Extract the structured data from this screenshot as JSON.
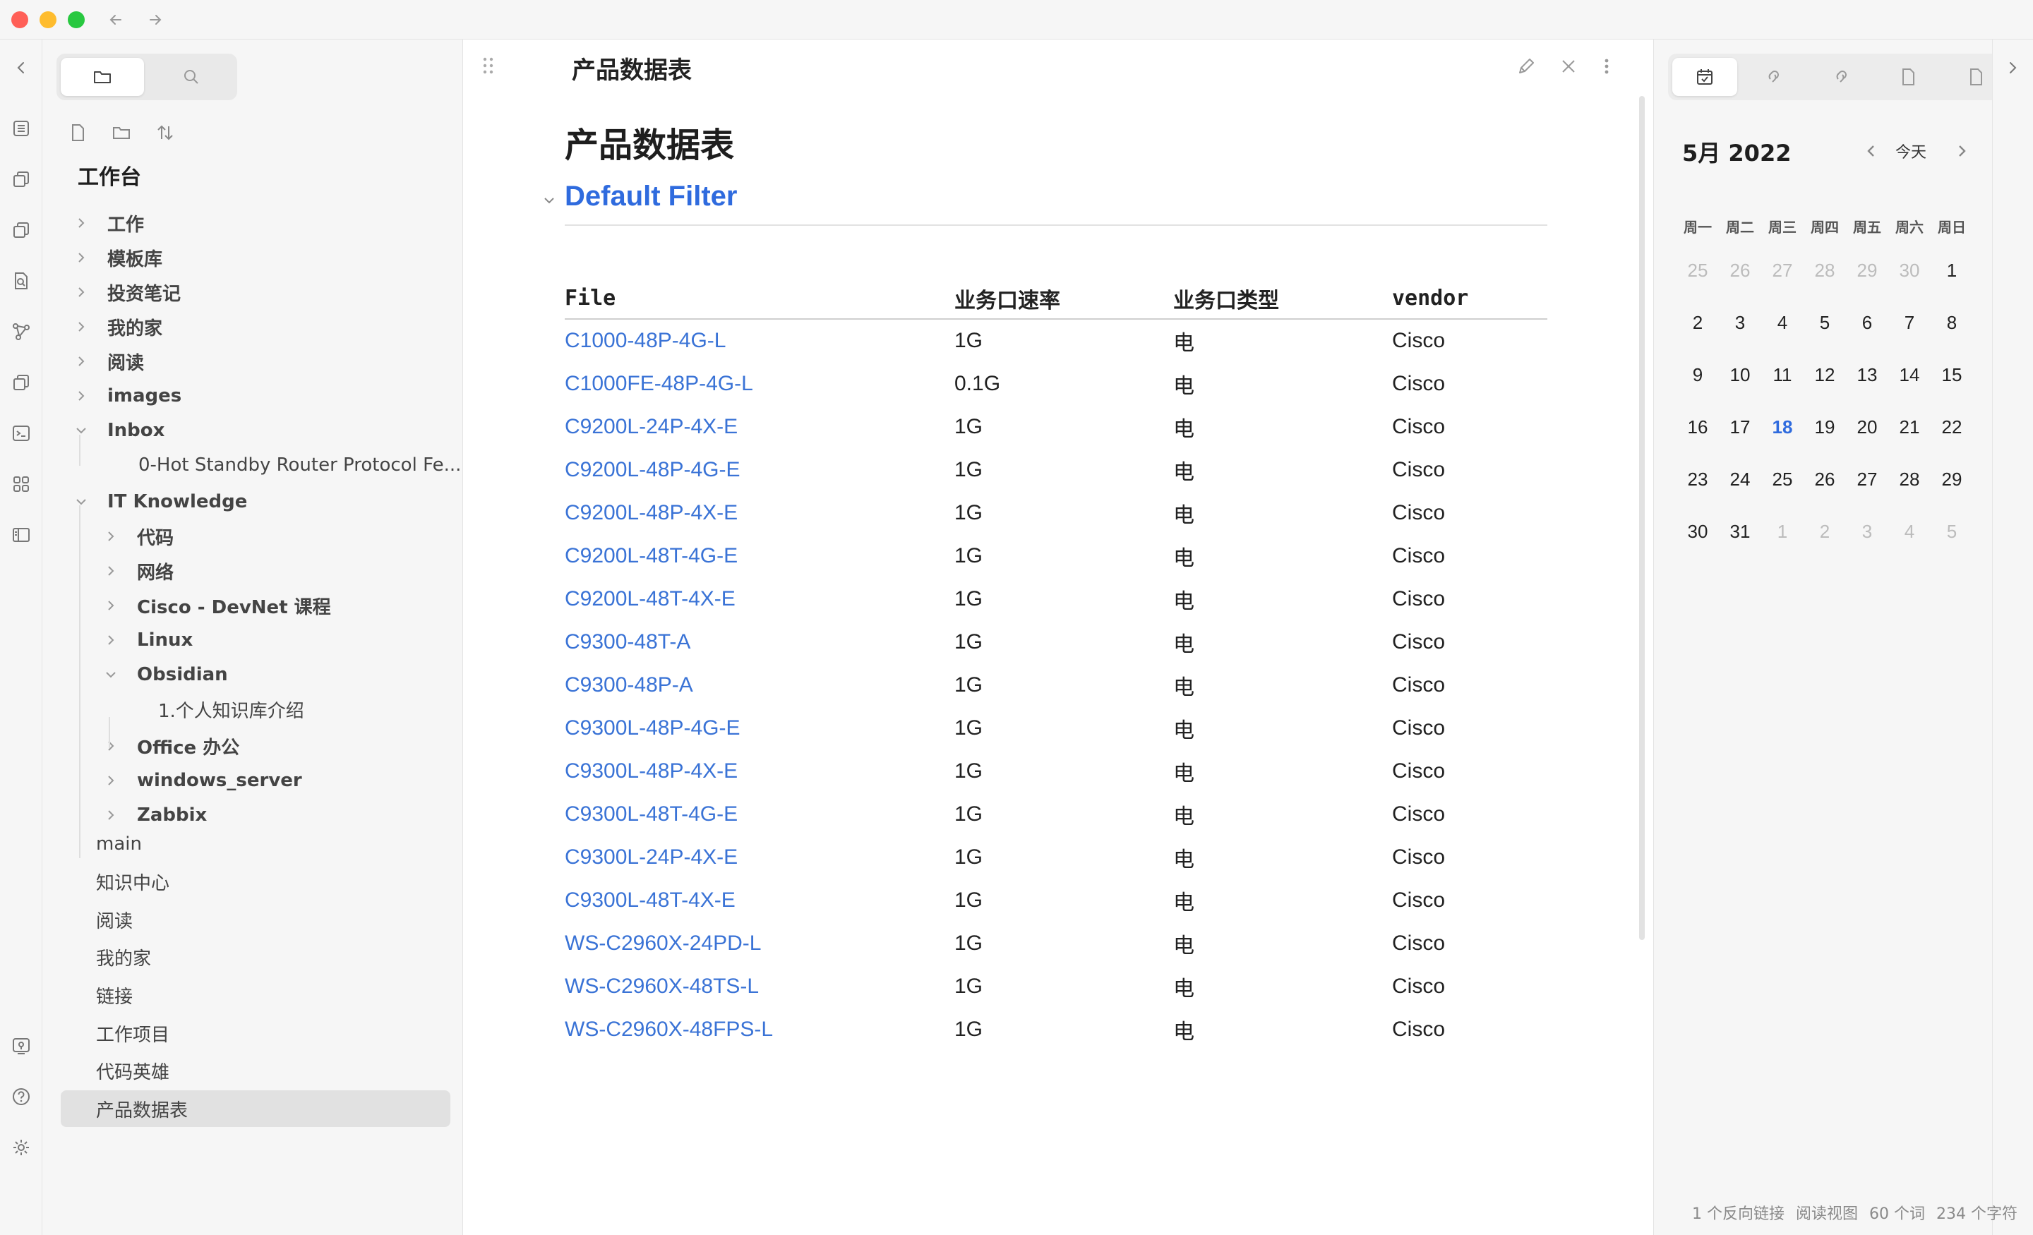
{
  "ribbon": {
    "icons": [
      "collapse-left-icon",
      "outline-icon",
      "copy-icon",
      "copy-icon-2",
      "file-search-icon",
      "graph-icon",
      "copy-icon-3",
      "terminal-icon",
      "grid-icon",
      "sidebar-layout-icon"
    ],
    "bottom_icons": [
      "vault-switch-icon",
      "help-icon",
      "settings-icon"
    ]
  },
  "sidebar": {
    "vault_name": "工作台",
    "tree": [
      {
        "label": "工作",
        "type": "folder",
        "depth": 0,
        "expanded": false
      },
      {
        "label": "模板库",
        "type": "folder",
        "depth": 0,
        "expanded": false
      },
      {
        "label": "投资笔记",
        "type": "folder",
        "depth": 0,
        "expanded": false
      },
      {
        "label": "我的家",
        "type": "folder",
        "depth": 0,
        "expanded": false
      },
      {
        "label": "阅读",
        "type": "folder",
        "depth": 0,
        "expanded": false
      },
      {
        "label": "images",
        "type": "folder",
        "depth": 0,
        "expanded": false
      },
      {
        "label": "Inbox",
        "type": "folder",
        "depth": 0,
        "expanded": true
      },
      {
        "label": "0-Hot Standby Router Protocol Fe...",
        "type": "file",
        "depth": 1
      },
      {
        "label": "IT Knowledge",
        "type": "folder",
        "depth": 0,
        "expanded": true
      },
      {
        "label": "代码",
        "type": "folder",
        "depth": 1,
        "expanded": false
      },
      {
        "label": "网络",
        "type": "folder",
        "depth": 1,
        "expanded": false
      },
      {
        "label": "Cisco - DevNet 课程",
        "type": "folder",
        "depth": 1,
        "expanded": false
      },
      {
        "label": "Linux",
        "type": "folder",
        "depth": 1,
        "expanded": false
      },
      {
        "label": "Obsidian",
        "type": "folder",
        "depth": 1,
        "expanded": true
      },
      {
        "label": "1.个人知识库介绍",
        "type": "file",
        "depth": 2
      },
      {
        "label": "Office 办公",
        "type": "folder",
        "depth": 1,
        "expanded": false
      },
      {
        "label": "windows_server",
        "type": "folder",
        "depth": 1,
        "expanded": false
      },
      {
        "label": "Zabbix",
        "type": "folder",
        "depth": 1,
        "expanded": false
      }
    ],
    "root_files": [
      "main",
      "知识中心",
      "阅读",
      "我的家",
      "链接",
      "工作项目",
      "代码英雄",
      "产品数据表"
    ],
    "active_file": "产品数据表"
  },
  "editor": {
    "view_title": "产品数据表",
    "doc_title": "产品数据表",
    "section_heading": "Default Filter",
    "table": {
      "headers": [
        "File",
        "业务口速率",
        "业务口类型",
        "vendor"
      ],
      "rows": [
        [
          "C1000-48P-4G-L",
          "1G",
          "电",
          "Cisco"
        ],
        [
          "C1000FE-48P-4G-L",
          "0.1G",
          "电",
          "Cisco"
        ],
        [
          "C9200L-24P-4X-E",
          "1G",
          "电",
          "Cisco"
        ],
        [
          "C9200L-48P-4G-E",
          "1G",
          "电",
          "Cisco"
        ],
        [
          "C9200L-48P-4X-E",
          "1G",
          "电",
          "Cisco"
        ],
        [
          "C9200L-48T-4G-E",
          "1G",
          "电",
          "Cisco"
        ],
        [
          "C9200L-48T-4X-E",
          "1G",
          "电",
          "Cisco"
        ],
        [
          "C9300-48T-A",
          "1G",
          "电",
          "Cisco"
        ],
        [
          "C9300-48P-A",
          "1G",
          "电",
          "Cisco"
        ],
        [
          "C9300L-48P-4G-E",
          "1G",
          "电",
          "Cisco"
        ],
        [
          "C9300L-48P-4X-E",
          "1G",
          "电",
          "Cisco"
        ],
        [
          "C9300L-48T-4G-E",
          "1G",
          "电",
          "Cisco"
        ],
        [
          "C9300L-24P-4X-E",
          "1G",
          "电",
          "Cisco"
        ],
        [
          "C9300L-48T-4X-E",
          "1G",
          "电",
          "Cisco"
        ],
        [
          "WS-C2960X-24PD-L",
          "1G",
          "电",
          "Cisco"
        ],
        [
          "WS-C2960X-48TS-L",
          "1G",
          "电",
          "Cisco"
        ],
        [
          "WS-C2960X-48FPS-L",
          "1G",
          "电",
          "Cisco"
        ]
      ]
    }
  },
  "calendar": {
    "month_label": "5月 2022",
    "today_label": "今天",
    "weekdays": [
      "周一",
      "周二",
      "周三",
      "周四",
      "周五",
      "周六",
      "周日"
    ],
    "weeks": [
      [
        {
          "d": "25",
          "dim": true
        },
        {
          "d": "26",
          "dim": true
        },
        {
          "d": "27",
          "dim": true
        },
        {
          "d": "28",
          "dim": true
        },
        {
          "d": "29",
          "dim": true
        },
        {
          "d": "30",
          "dim": true
        },
        {
          "d": "1"
        }
      ],
      [
        {
          "d": "2"
        },
        {
          "d": "3"
        },
        {
          "d": "4"
        },
        {
          "d": "5"
        },
        {
          "d": "6"
        },
        {
          "d": "7"
        },
        {
          "d": "8"
        }
      ],
      [
        {
          "d": "9"
        },
        {
          "d": "10"
        },
        {
          "d": "11"
        },
        {
          "d": "12"
        },
        {
          "d": "13"
        },
        {
          "d": "14"
        },
        {
          "d": "15"
        }
      ],
      [
        {
          "d": "16"
        },
        {
          "d": "17"
        },
        {
          "d": "18",
          "today": true
        },
        {
          "d": "19"
        },
        {
          "d": "20"
        },
        {
          "d": "21"
        },
        {
          "d": "22"
        }
      ],
      [
        {
          "d": "23"
        },
        {
          "d": "24"
        },
        {
          "d": "25"
        },
        {
          "d": "26"
        },
        {
          "d": "27"
        },
        {
          "d": "28"
        },
        {
          "d": "29"
        }
      ],
      [
        {
          "d": "30"
        },
        {
          "d": "31"
        },
        {
          "d": "1",
          "dim": true
        },
        {
          "d": "2",
          "dim": true
        },
        {
          "d": "3",
          "dim": true
        },
        {
          "d": "4",
          "dim": true
        },
        {
          "d": "5",
          "dim": true
        }
      ]
    ]
  },
  "status": {
    "backlinks": "1 个反向链接",
    "mode": "阅读视图",
    "words": "60 个词",
    "chars": "234 个字符"
  },
  "colors": {
    "accent": "#2f6bde",
    "link": "#3a73d6",
    "panel_bg": "#f6f6f6"
  }
}
